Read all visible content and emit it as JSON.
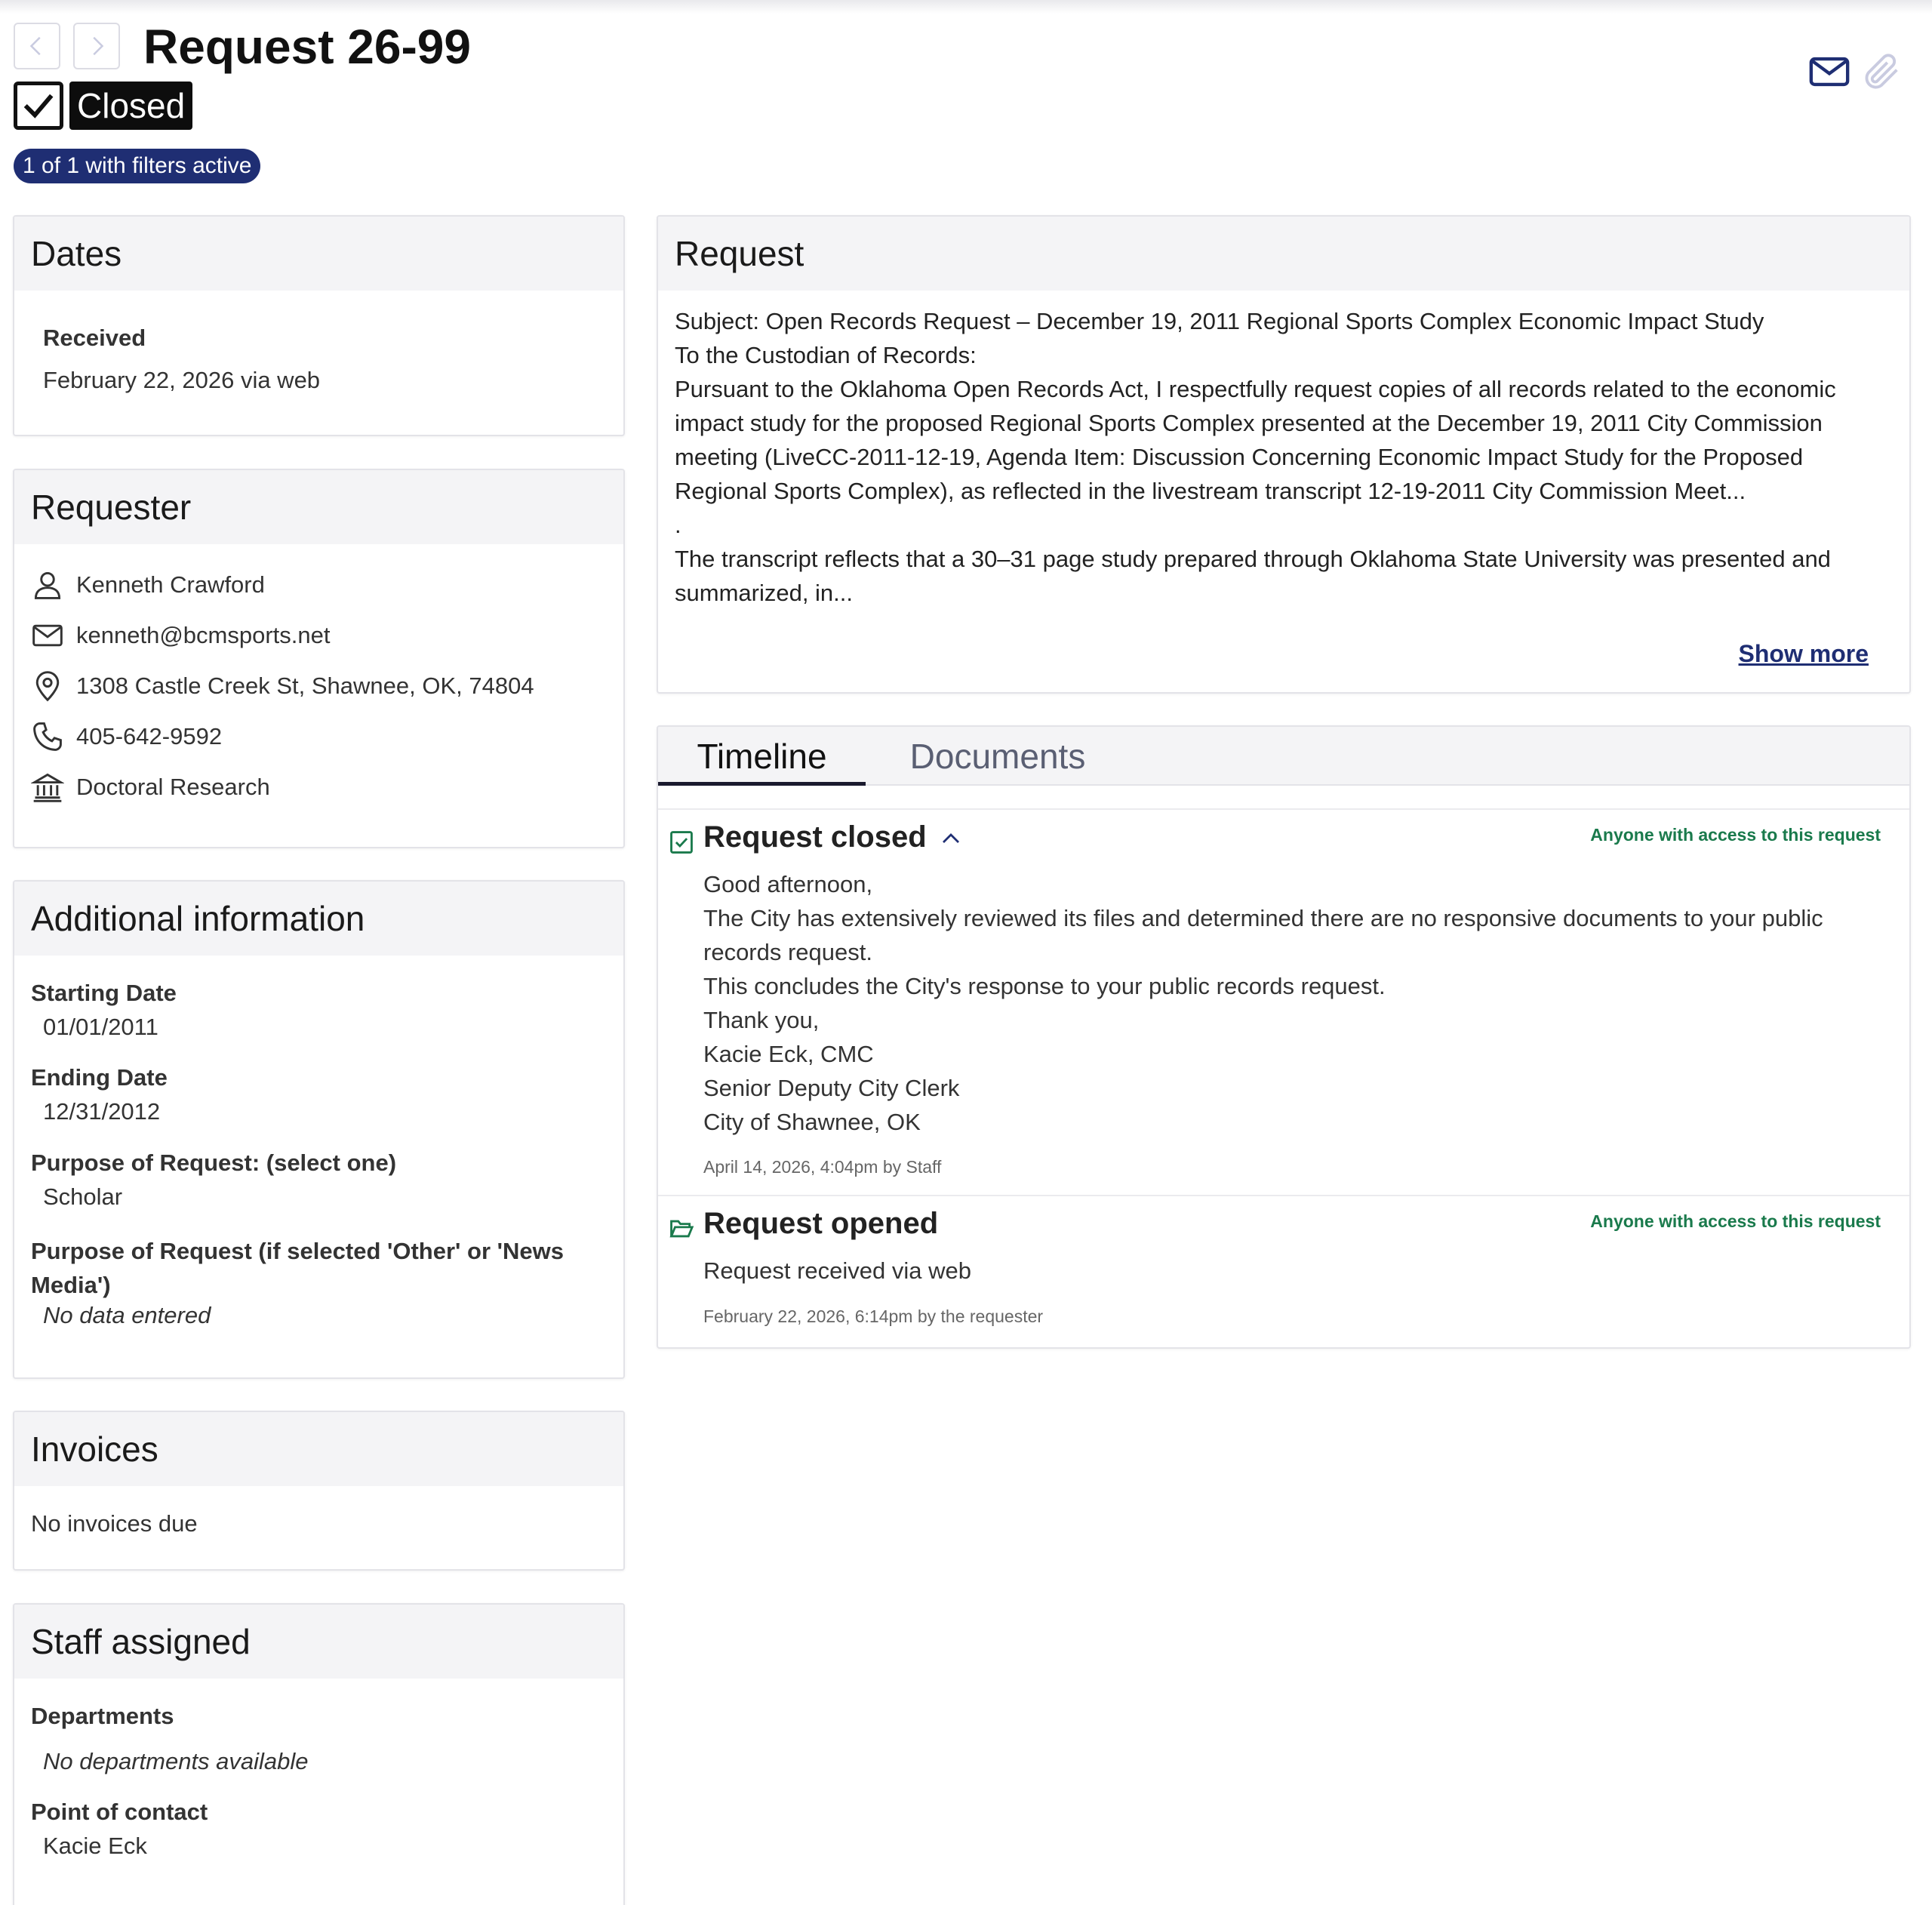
{
  "header": {
    "title": "Request 26-99",
    "status": "Closed",
    "filter_pill": "1 of 1 with filters active",
    "icons": {
      "prev": "chevron-left-icon",
      "next": "chevron-right-icon",
      "email": "envelope-icon",
      "attachment": "paperclip-icon"
    }
  },
  "dates": {
    "heading": "Dates",
    "received_label": "Received",
    "received_value": "February 22, 2026 via web"
  },
  "requester": {
    "heading": "Requester",
    "name": "Kenneth Crawford",
    "email": "kenneth@bcmsports.net",
    "address": "1308 Castle Creek St, Shawnee, OK, 74804",
    "phone": "405-642-9592",
    "organization": "Doctoral Research"
  },
  "additional": {
    "heading": "Additional information",
    "fields": [
      {
        "label": "Starting Date",
        "value": "01/01/2011"
      },
      {
        "label": "Ending Date",
        "value": "12/31/2012"
      },
      {
        "label": "Purpose of Request: (select one)",
        "value": "Scholar"
      },
      {
        "label": "Purpose of Request (if selected 'Other' or 'News Media')",
        "value": "No data entered"
      }
    ]
  },
  "invoices": {
    "heading": "Invoices",
    "text": "No invoices due"
  },
  "staff": {
    "heading": "Staff assigned",
    "departments_label": "Departments",
    "departments_value": "No departments available",
    "poc_label": "Point of contact",
    "poc_value": "Kacie Eck"
  },
  "request": {
    "heading": "Request",
    "lines": [
      "Subject: Open Records Request – December 19, 2011 Regional Sports Complex Economic Impact Study",
      "To the Custodian of Records:",
      "Pursuant to the Oklahoma Open Records Act, I respectfully request copies of all records related to the economic impact study for the proposed Regional Sports Complex presented at the December 19, 2011 City Commission meeting (LiveCC-2011-12-19, Agenda Item: Discussion Concerning Economic Impact Study for the Proposed Regional Sports Complex), as reflected in the livestream transcript 12-19-2011 City Commission Meet...",
      ".",
      "The transcript reflects that a 30–31 page study prepared through Oklahoma State University was presented and summarized, in..."
    ],
    "show_more": "Show more"
  },
  "timeline": {
    "tabs": [
      "Timeline",
      "Documents"
    ],
    "entries": [
      {
        "title": "Request closed",
        "visibility": "Anyone with access to this request",
        "body": [
          "Good afternoon,",
          "The City has extensively reviewed its files and determined there are no responsive documents to your public records request.",
          "This concludes the City's response to your public records request.",
          "Thank you,",
          "Kacie Eck, CMC",
          "Senior Deputy City Clerk",
          "City of Shawnee, OK"
        ],
        "meta": "April 14, 2026, 4:04pm by Staff"
      },
      {
        "title": "Request opened",
        "visibility": "Anyone with access to this request",
        "body": [
          "Request received via web"
        ],
        "meta": "February 22, 2026, 6:14pm by the requester"
      }
    ]
  },
  "colors": {
    "brand_navy": "#1f2e73",
    "success_green": "#1a7a4c",
    "panel_header_bg": "#f4f4f6"
  }
}
